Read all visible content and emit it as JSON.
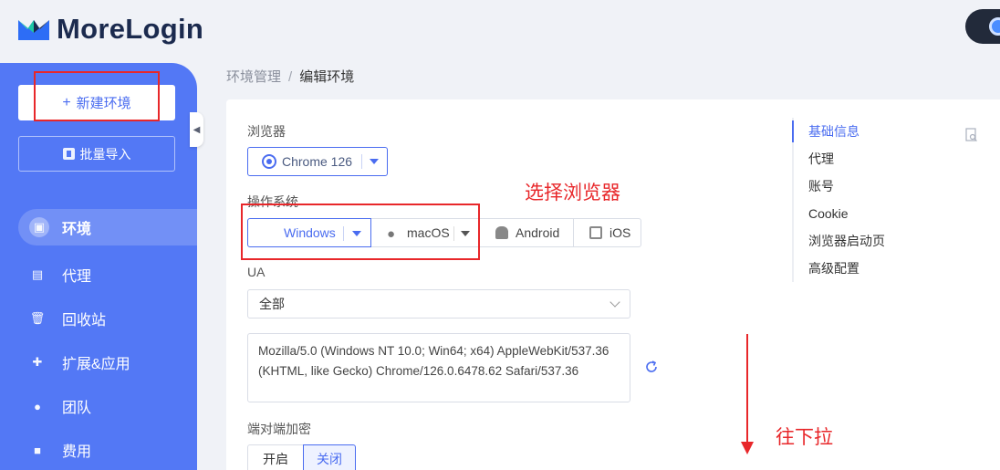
{
  "app": {
    "logo_text": "MoreLogin"
  },
  "sidebar": {
    "new_env_label": "新建环境",
    "new_env_plus": "+",
    "batch_import_label": "批量导入",
    "items": [
      {
        "label": "环境",
        "icon": "environment-icon",
        "active": true
      },
      {
        "label": "代理",
        "icon": "proxy-icon"
      },
      {
        "label": "回收站",
        "icon": "trash-icon"
      },
      {
        "label": "扩展&应用",
        "icon": "puzzle-icon"
      },
      {
        "label": "团队",
        "icon": "team-icon"
      },
      {
        "label": "费用",
        "icon": "wallet-icon"
      }
    ]
  },
  "breadcrumb": {
    "parent": "环境管理",
    "separator": "/",
    "current": "编辑环境"
  },
  "form": {
    "browser_label": "浏览器",
    "browser_value": "Chrome 126",
    "os_label": "操作系统",
    "os_options": [
      "Windows",
      "macOS",
      "Android",
      "iOS"
    ],
    "os_selected": "Windows",
    "ua_label": "UA",
    "ua_select_value": "全部",
    "ua_string": "Mozilla/5.0 (Windows NT 10.0; Win64; x64) AppleWebKit/537.36 (KHTML, like Gecko) Chrome/126.0.6478.62 Safari/537.36",
    "e2e_label": "端对端加密",
    "e2e_on": "开启",
    "e2e_off": "关闭",
    "e2e_selected": "关闭"
  },
  "anchor_nav": {
    "items": [
      "基础信息",
      "代理",
      "账号",
      "Cookie",
      "浏览器启动页",
      "高级配置"
    ],
    "active": "基础信息"
  },
  "annotations": {
    "select_browser": "选择浏览器",
    "scroll_down": "往下拉"
  },
  "colors": {
    "accent": "#4a6cf0",
    "sidebar": "#5378f5",
    "annotation": "#e8272a"
  }
}
